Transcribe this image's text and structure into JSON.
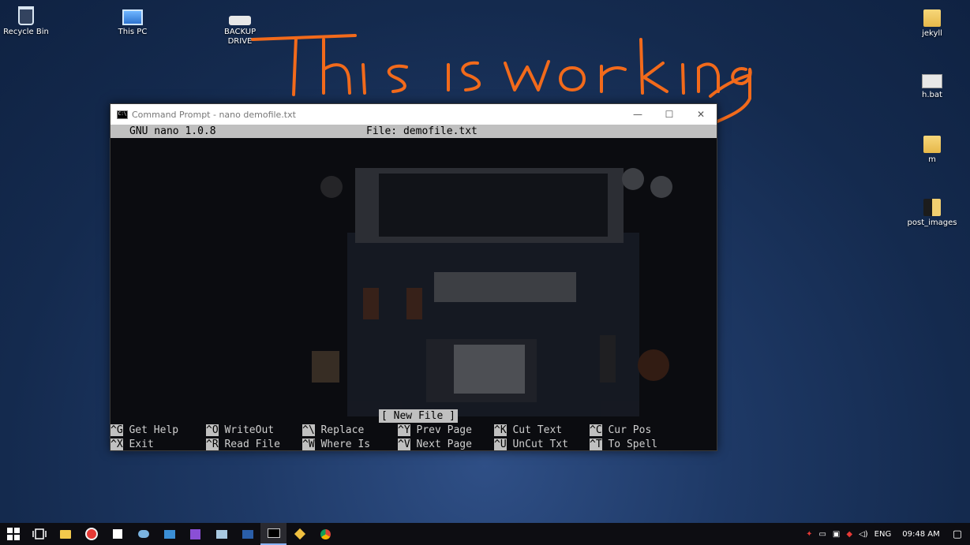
{
  "desktop_icons": {
    "recycle_bin": "Recycle Bin",
    "this_pc": "This PC",
    "backup_drive": "BACKUP DRIVE",
    "jekyll": "jekyll",
    "h_bat": "h.bat",
    "m": "m",
    "post_images": "post_images"
  },
  "annotation": {
    "text": "This is working",
    "color": "#f26a1b"
  },
  "window": {
    "title": "Command Prompt - nano  demofile.txt",
    "icon_text": "C:\\",
    "minimize": "—",
    "maximize": "☐",
    "close": "✕"
  },
  "nano": {
    "version": "GNU nano 1.0.8",
    "file": "File: demofile.txt",
    "status": "[ New File ]",
    "shortcuts": [
      {
        "key": "^G",
        "label": " Get Help"
      },
      {
        "key": "^O",
        "label": " WriteOut"
      },
      {
        "key": "^\\",
        "label": " Replace"
      },
      {
        "key": "^Y",
        "label": " Prev Page"
      },
      {
        "key": "^K",
        "label": " Cut Text"
      },
      {
        "key": "^C",
        "label": " Cur Pos"
      },
      {
        "key": "^X",
        "label": " Exit"
      },
      {
        "key": "^R",
        "label": " Read File"
      },
      {
        "key": "^W",
        "label": " Where Is"
      },
      {
        "key": "^V",
        "label": " Next Page"
      },
      {
        "key": "^U",
        "label": " UnCut Txt"
      },
      {
        "key": "^T",
        "label": " To Spell"
      }
    ]
  },
  "taskbar": {
    "lang": "ENG",
    "time": "09:48 AM"
  }
}
